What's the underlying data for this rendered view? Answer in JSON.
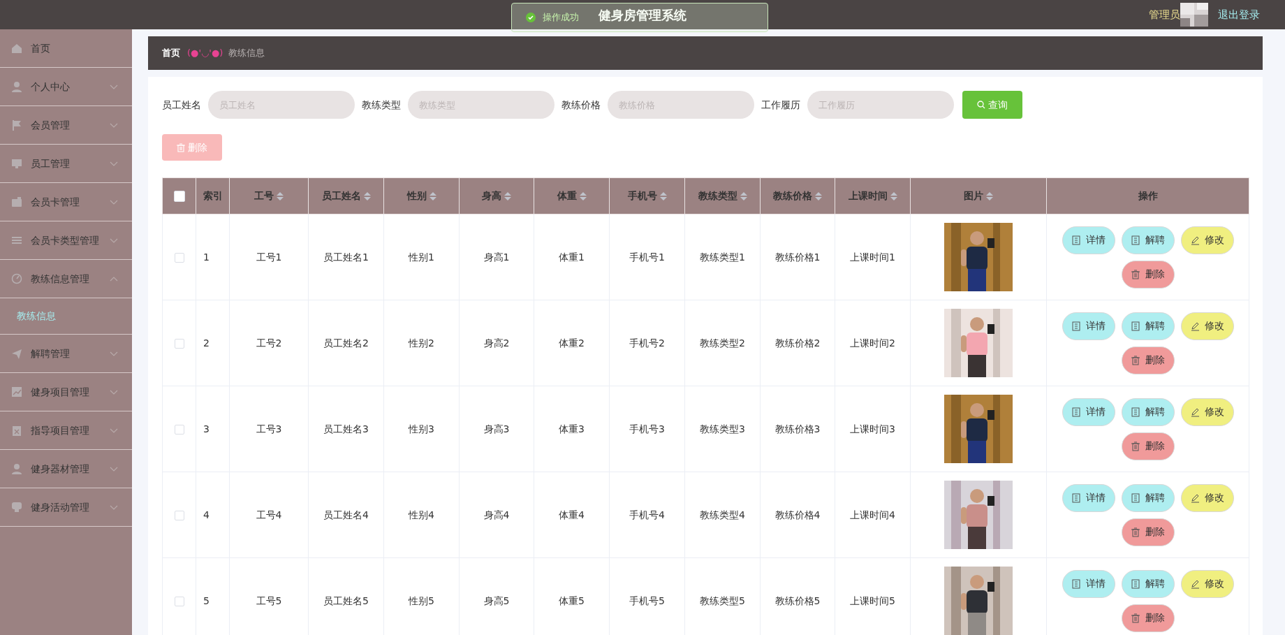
{
  "header": {
    "title": "健身房管理系统",
    "user": "管理员",
    "logout": "退出登录"
  },
  "toast": {
    "kind": "success",
    "message": "操作成功"
  },
  "sidebar": {
    "items": [
      {
        "label": "首页",
        "kind": "link"
      },
      {
        "label": "个人中心",
        "kind": "menu",
        "expanded": false
      },
      {
        "label": "会员管理",
        "kind": "menu",
        "expanded": false
      },
      {
        "label": "员工管理",
        "kind": "menu",
        "expanded": false
      },
      {
        "label": "会员卡管理",
        "kind": "menu",
        "expanded": false
      },
      {
        "label": "会员卡类型管理",
        "kind": "menu",
        "expanded": false
      },
      {
        "label": "教练信息管理",
        "kind": "menu",
        "expanded": true,
        "children": [
          {
            "label": "教练信息",
            "selected": true
          }
        ]
      },
      {
        "label": "解聘管理",
        "kind": "menu",
        "expanded": false
      },
      {
        "label": "健身项目管理",
        "kind": "menu",
        "expanded": false
      },
      {
        "label": "指导项目管理",
        "kind": "menu",
        "expanded": false
      },
      {
        "label": "健身器材管理",
        "kind": "menu",
        "expanded": false
      },
      {
        "label": "健身活动管理",
        "kind": "menu",
        "expanded": false
      }
    ]
  },
  "breadcrumb": {
    "home": "首页",
    "emoticon": "(●'◡'●)",
    "current": "教练信息"
  },
  "search": {
    "fields": [
      {
        "label": "员工姓名",
        "placeholder": "员工姓名"
      },
      {
        "label": "教练类型",
        "placeholder": "教练类型"
      },
      {
        "label": "教练价格",
        "placeholder": "教练价格"
      },
      {
        "label": "工作履历",
        "placeholder": "工作履历"
      }
    ],
    "button": "查询"
  },
  "bulk_delete": {
    "label": "删除",
    "disabled": true
  },
  "table": {
    "select_all": {
      "checked": false
    },
    "columns": [
      {
        "label": "索引",
        "sortable": false
      },
      {
        "label": "工号",
        "sortable": true
      },
      {
        "label": "员工姓名",
        "sortable": true
      },
      {
        "label": "性别",
        "sortable": true
      },
      {
        "label": "身高",
        "sortable": true
      },
      {
        "label": "体重",
        "sortable": true
      },
      {
        "label": "手机号",
        "sortable": true
      },
      {
        "label": "教练类型",
        "sortable": true
      },
      {
        "label": "教练价格",
        "sortable": true
      },
      {
        "label": "上课时间",
        "sortable": true
      },
      {
        "label": "图片",
        "sortable": true
      },
      {
        "label": "操作",
        "sortable": false
      }
    ],
    "rows": [
      {
        "checked": false,
        "cells": [
          "1",
          "工号1",
          "员工姓名1",
          "性别1",
          "身高1",
          "体重1",
          "手机号1",
          "教练类型1",
          "教练价格1",
          "上课时间1"
        ],
        "actions": [
          {
            "kind": "detail",
            "label": "详情"
          },
          {
            "kind": "dismiss",
            "label": "解聘"
          },
          {
            "kind": "edit",
            "label": "修改"
          },
          {
            "kind": "delete",
            "label": "删除"
          }
        ]
      },
      {
        "checked": false,
        "cells": [
          "2",
          "工号2",
          "员工姓名2",
          "性别2",
          "身高2",
          "体重2",
          "手机号2",
          "教练类型2",
          "教练价格2",
          "上课时间2"
        ],
        "actions": [
          {
            "kind": "detail",
            "label": "详情"
          },
          {
            "kind": "dismiss",
            "label": "解聘"
          },
          {
            "kind": "edit",
            "label": "修改"
          },
          {
            "kind": "delete",
            "label": "删除"
          }
        ]
      },
      {
        "checked": false,
        "cells": [
          "3",
          "工号3",
          "员工姓名3",
          "性别3",
          "身高3",
          "体重3",
          "手机号3",
          "教练类型3",
          "教练价格3",
          "上课时间3"
        ],
        "actions": [
          {
            "kind": "detail",
            "label": "详情"
          },
          {
            "kind": "dismiss",
            "label": "解聘"
          },
          {
            "kind": "edit",
            "label": "修改"
          },
          {
            "kind": "delete",
            "label": "删除"
          }
        ]
      },
      {
        "checked": false,
        "cells": [
          "4",
          "工号4",
          "员工姓名4",
          "性别4",
          "身高4",
          "体重4",
          "手机号4",
          "教练类型4",
          "教练价格4",
          "上课时间4"
        ],
        "actions": [
          {
            "kind": "detail",
            "label": "详情"
          },
          {
            "kind": "dismiss",
            "label": "解聘"
          },
          {
            "kind": "edit",
            "label": "修改"
          },
          {
            "kind": "delete",
            "label": "删除"
          }
        ]
      },
      {
        "checked": false,
        "cells": [
          "5",
          "工号5",
          "员工姓名5",
          "性别5",
          "身高5",
          "体重5",
          "手机号5",
          "教练类型5",
          "教练价格5",
          "上课时间5"
        ],
        "actions": [
          {
            "kind": "detail",
            "label": "详情"
          },
          {
            "kind": "dismiss",
            "label": "解聘"
          },
          {
            "kind": "edit",
            "label": "修改"
          },
          {
            "kind": "delete",
            "label": "删除"
          }
        ]
      }
    ]
  }
}
